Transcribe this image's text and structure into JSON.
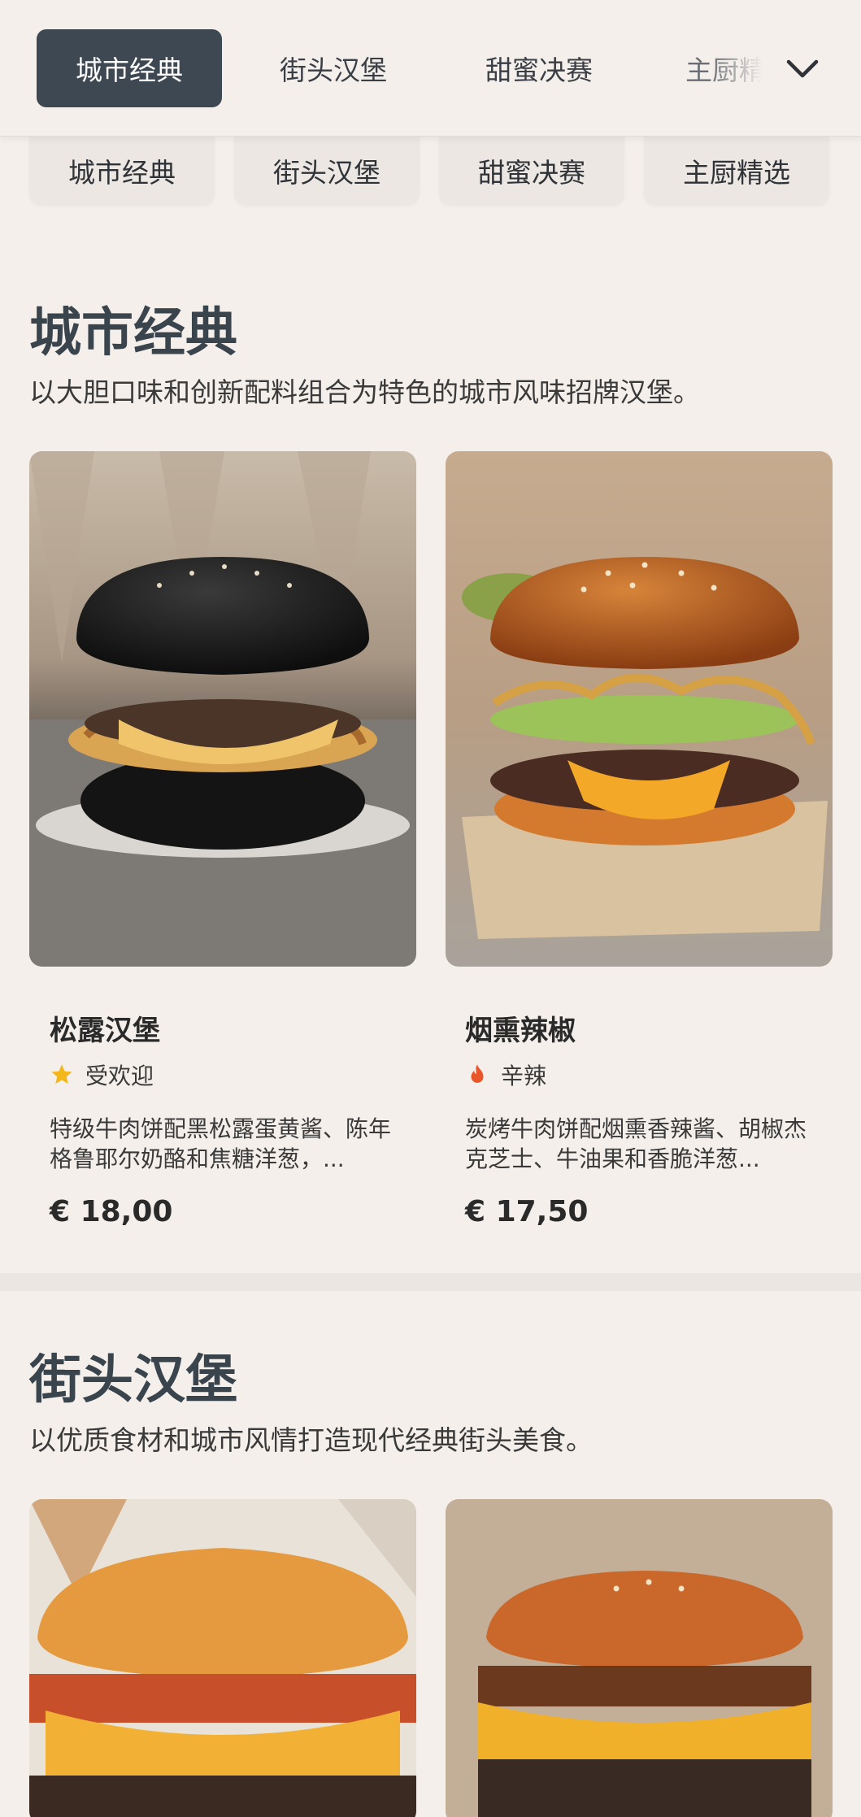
{
  "top_tabs": [
    {
      "label": "城市经典",
      "active": true
    },
    {
      "label": "街头汉堡",
      "active": false
    },
    {
      "label": "甜蜜决赛",
      "active": false
    },
    {
      "label": "主厨精选",
      "active": false
    }
  ],
  "more_icon": "chevron-down-icon",
  "chips": [
    "城市经典",
    "街头汉堡",
    "甜蜜决赛",
    "主厨精选"
  ],
  "sections": [
    {
      "title": "城市经典",
      "description": "以大胆口味和创新配料组合为特色的城市风味招牌汉堡。",
      "products": [
        {
          "name": "松露汉堡",
          "tag": "受欢迎",
          "tag_icon": "star-icon",
          "description": "特级牛肉饼配黑松露蛋黄酱、陈年格鲁耶尔奶酪和焦糖洋葱，...",
          "price": "€ 18,00"
        },
        {
          "name": "烟熏辣椒",
          "tag": "辛辣",
          "tag_icon": "flame-icon",
          "description": "炭烤牛肉饼配烟熏香辣酱、胡椒杰克芝士、牛油果和香脆洋葱...",
          "price": "€ 17,50"
        }
      ]
    },
    {
      "title": "街头汉堡",
      "description": "以优质食材和城市风情打造现代经典街头美食。",
      "products": [
        {
          "image": "burger-photo"
        },
        {
          "image": "burger-photo"
        }
      ]
    }
  ],
  "colors": {
    "background": "#f4efeb",
    "active_tab": "#3d4852",
    "heading": "#3a444d",
    "star": "#f3b61b",
    "flame": "#e8562a"
  }
}
